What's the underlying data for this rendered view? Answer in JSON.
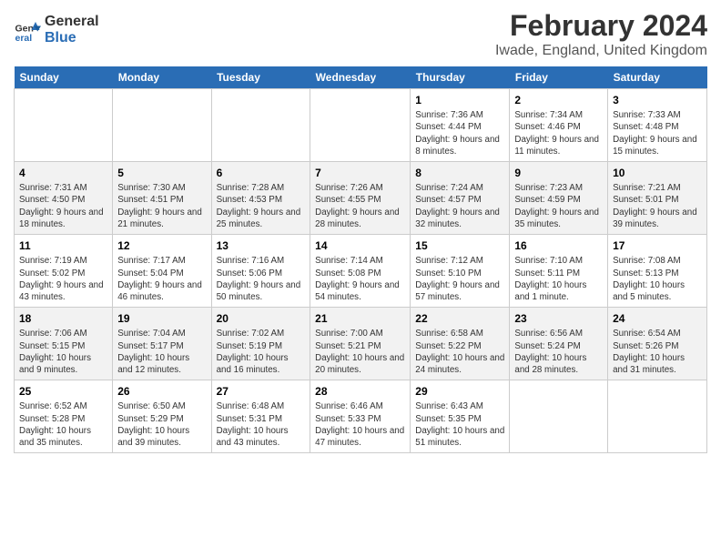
{
  "logo": {
    "line1": "General",
    "line2": "Blue"
  },
  "title": "February 2024",
  "subtitle": "Iwade, England, United Kingdom",
  "days_of_week": [
    "Sunday",
    "Monday",
    "Tuesday",
    "Wednesday",
    "Thursday",
    "Friday",
    "Saturday"
  ],
  "weeks": [
    [
      {
        "day": "",
        "info": ""
      },
      {
        "day": "",
        "info": ""
      },
      {
        "day": "",
        "info": ""
      },
      {
        "day": "",
        "info": ""
      },
      {
        "day": "1",
        "info": "Sunrise: 7:36 AM\nSunset: 4:44 PM\nDaylight: 9 hours and 8 minutes."
      },
      {
        "day": "2",
        "info": "Sunrise: 7:34 AM\nSunset: 4:46 PM\nDaylight: 9 hours and 11 minutes."
      },
      {
        "day": "3",
        "info": "Sunrise: 7:33 AM\nSunset: 4:48 PM\nDaylight: 9 hours and 15 minutes."
      }
    ],
    [
      {
        "day": "4",
        "info": "Sunrise: 7:31 AM\nSunset: 4:50 PM\nDaylight: 9 hours and 18 minutes."
      },
      {
        "day": "5",
        "info": "Sunrise: 7:30 AM\nSunset: 4:51 PM\nDaylight: 9 hours and 21 minutes."
      },
      {
        "day": "6",
        "info": "Sunrise: 7:28 AM\nSunset: 4:53 PM\nDaylight: 9 hours and 25 minutes."
      },
      {
        "day": "7",
        "info": "Sunrise: 7:26 AM\nSunset: 4:55 PM\nDaylight: 9 hours and 28 minutes."
      },
      {
        "day": "8",
        "info": "Sunrise: 7:24 AM\nSunset: 4:57 PM\nDaylight: 9 hours and 32 minutes."
      },
      {
        "day": "9",
        "info": "Sunrise: 7:23 AM\nSunset: 4:59 PM\nDaylight: 9 hours and 35 minutes."
      },
      {
        "day": "10",
        "info": "Sunrise: 7:21 AM\nSunset: 5:01 PM\nDaylight: 9 hours and 39 minutes."
      }
    ],
    [
      {
        "day": "11",
        "info": "Sunrise: 7:19 AM\nSunset: 5:02 PM\nDaylight: 9 hours and 43 minutes."
      },
      {
        "day": "12",
        "info": "Sunrise: 7:17 AM\nSunset: 5:04 PM\nDaylight: 9 hours and 46 minutes."
      },
      {
        "day": "13",
        "info": "Sunrise: 7:16 AM\nSunset: 5:06 PM\nDaylight: 9 hours and 50 minutes."
      },
      {
        "day": "14",
        "info": "Sunrise: 7:14 AM\nSunset: 5:08 PM\nDaylight: 9 hours and 54 minutes."
      },
      {
        "day": "15",
        "info": "Sunrise: 7:12 AM\nSunset: 5:10 PM\nDaylight: 9 hours and 57 minutes."
      },
      {
        "day": "16",
        "info": "Sunrise: 7:10 AM\nSunset: 5:11 PM\nDaylight: 10 hours and 1 minute."
      },
      {
        "day": "17",
        "info": "Sunrise: 7:08 AM\nSunset: 5:13 PM\nDaylight: 10 hours and 5 minutes."
      }
    ],
    [
      {
        "day": "18",
        "info": "Sunrise: 7:06 AM\nSunset: 5:15 PM\nDaylight: 10 hours and 9 minutes."
      },
      {
        "day": "19",
        "info": "Sunrise: 7:04 AM\nSunset: 5:17 PM\nDaylight: 10 hours and 12 minutes."
      },
      {
        "day": "20",
        "info": "Sunrise: 7:02 AM\nSunset: 5:19 PM\nDaylight: 10 hours and 16 minutes."
      },
      {
        "day": "21",
        "info": "Sunrise: 7:00 AM\nSunset: 5:21 PM\nDaylight: 10 hours and 20 minutes."
      },
      {
        "day": "22",
        "info": "Sunrise: 6:58 AM\nSunset: 5:22 PM\nDaylight: 10 hours and 24 minutes."
      },
      {
        "day": "23",
        "info": "Sunrise: 6:56 AM\nSunset: 5:24 PM\nDaylight: 10 hours and 28 minutes."
      },
      {
        "day": "24",
        "info": "Sunrise: 6:54 AM\nSunset: 5:26 PM\nDaylight: 10 hours and 31 minutes."
      }
    ],
    [
      {
        "day": "25",
        "info": "Sunrise: 6:52 AM\nSunset: 5:28 PM\nDaylight: 10 hours and 35 minutes."
      },
      {
        "day": "26",
        "info": "Sunrise: 6:50 AM\nSunset: 5:29 PM\nDaylight: 10 hours and 39 minutes."
      },
      {
        "day": "27",
        "info": "Sunrise: 6:48 AM\nSunset: 5:31 PM\nDaylight: 10 hours and 43 minutes."
      },
      {
        "day": "28",
        "info": "Sunrise: 6:46 AM\nSunset: 5:33 PM\nDaylight: 10 hours and 47 minutes."
      },
      {
        "day": "29",
        "info": "Sunrise: 6:43 AM\nSunset: 5:35 PM\nDaylight: 10 hours and 51 minutes."
      },
      {
        "day": "",
        "info": ""
      },
      {
        "day": "",
        "info": ""
      }
    ]
  ]
}
